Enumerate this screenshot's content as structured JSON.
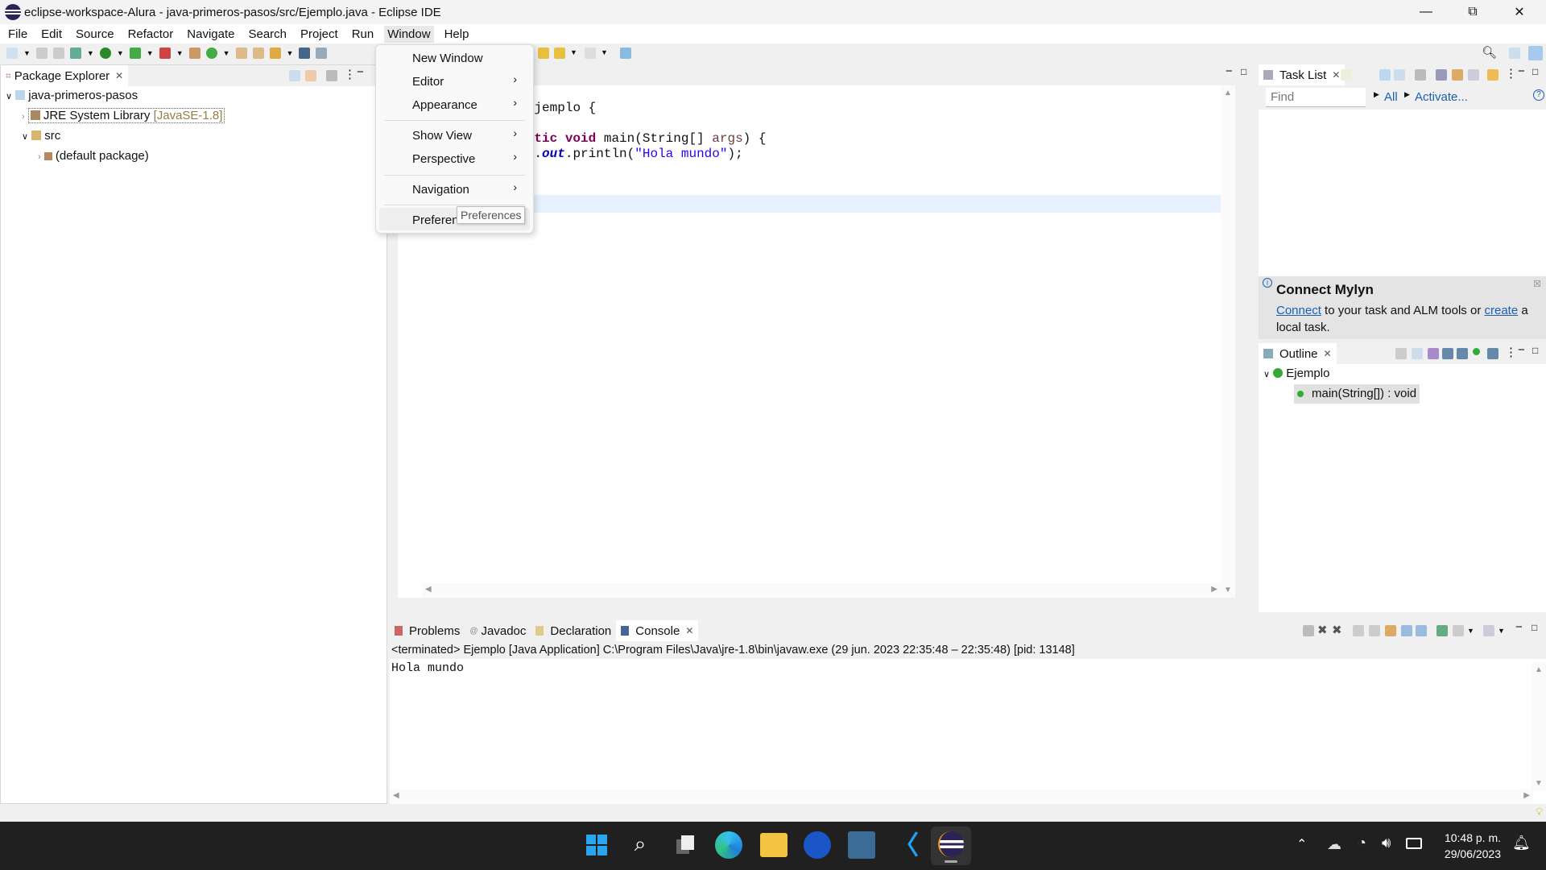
{
  "window": {
    "title": "eclipse-workspace-Alura - java-primeros-pasos/src/Ejemplo.java - Eclipse IDE",
    "controls": [
      "minimize",
      "restore",
      "close"
    ]
  },
  "menubar": [
    "File",
    "Edit",
    "Source",
    "Refactor",
    "Navigate",
    "Search",
    "Project",
    "Run",
    "Window",
    "Help"
  ],
  "window_menu": {
    "items": [
      {
        "label": "New Window",
        "submenu": false
      },
      {
        "label": "Editor",
        "submenu": true
      },
      {
        "label": "Appearance",
        "submenu": true
      },
      {
        "label": "Show View",
        "submenu": true
      },
      {
        "label": "Perspective",
        "submenu": true
      },
      {
        "label": "Navigation",
        "submenu": true
      },
      {
        "label": "Preferences",
        "submenu": false
      }
    ],
    "tooltip": "Preferences"
  },
  "package_explorer": {
    "tab": "Package Explorer",
    "tree": [
      {
        "label": "java-primeros-pasos",
        "level": 0,
        "expanded": true
      },
      {
        "label": "JRE System Library",
        "decoration": "[JavaSE-1.8]",
        "level": 1,
        "expanded": false
      },
      {
        "label": "src",
        "level": 1,
        "expanded": true
      },
      {
        "label": "(default package)",
        "level": 2,
        "expanded": false
      }
    ]
  },
  "editor": {
    "lines": [
      "public class Ejemplo {",
      "",
      "    public static void main(String[] args) {",
      "        System.out.println(\"Hola mundo\");",
      "    }",
      "",
      "}"
    ]
  },
  "task_list": {
    "tab": "Task List",
    "find_placeholder": "Find",
    "all": "All",
    "activate": "Activate..."
  },
  "mylyn": {
    "title": "Connect Mylyn",
    "connect": "Connect",
    "text1": " to your task and ALM tools or ",
    "create": "create",
    "text2": " a local task."
  },
  "outline": {
    "tab": "Outline",
    "class": "Ejemplo",
    "method": "main(String[]) : void"
  },
  "bottom": {
    "tabs": [
      "Problems",
      "Javadoc",
      "Declaration",
      "Console"
    ],
    "active": "Console",
    "status": "<terminated> Ejemplo [Java Application] C:\\Program Files\\Java\\jre-1.8\\bin\\javaw.exe  (29 jun. 2023 22:35:48 – 22:35:48) [pid: 13148]",
    "output": "Hola mundo"
  },
  "taskbar": {
    "apps": [
      "start",
      "search",
      "task-view",
      "edge",
      "file-explorer",
      "app-blue",
      "mysql-workbench",
      "vscode",
      "eclipse"
    ],
    "time": "10:48 p. m.",
    "date": "29/06/2023"
  },
  "colors": {
    "keyword": "#7f0055",
    "string": "#2a00ff",
    "link": "#1a5fb4",
    "taskbar": "#202020"
  }
}
